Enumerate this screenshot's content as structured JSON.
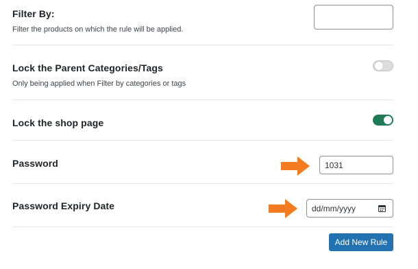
{
  "filter": {
    "label": "Filter By:",
    "description": "Filter the products on which the rule will be applied."
  },
  "lock_parent": {
    "label": "Lock the Parent Categories/Tags",
    "description": "Only being applied when Filter by categories or tags",
    "enabled": false
  },
  "lock_shop": {
    "label": "Lock the shop page",
    "enabled": true
  },
  "password": {
    "label": "Password",
    "value": "1031"
  },
  "expiry": {
    "label": "Password Expiry Date",
    "placeholder": "dd/mm/yyyy"
  },
  "actions": {
    "add_rule_label": "Add New Rule"
  },
  "colors": {
    "accent": "#2271b1",
    "toggle_on": "#1e7a57",
    "arrow": "#f47b20"
  },
  "icons": {
    "arrow": "arrow-right-icon",
    "calendar": "calendar-icon"
  }
}
